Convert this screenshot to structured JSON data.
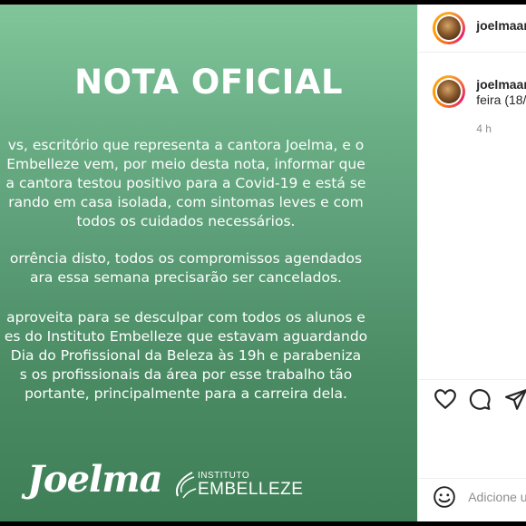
{
  "post": {
    "title": "NOTA OFICIAL",
    "para1": [
      "vs, escritório que representa a cantora Joelma, e o",
      "Embelleze vem, por meio desta nota, informar que",
      "a cantora testou positivo para a Covid-19 e está se",
      "rando em casa isolada, com sintomas leves e com",
      "todos os cuidados necessários."
    ],
    "para2": [
      "orrência disto, todos os compromissos agendados",
      "ara essa semana precisarão ser cancelados."
    ],
    "para3": [
      "aproveita para se desculpar com todos os alunos e",
      "es do Instituto Embelleze que estavam aguardando",
      "Dia do Profissional da Beleza às 19h e parabeniza",
      "s os profissionais da área por esse trabalho tão",
      "portante, principalmente para a carreira dela."
    ],
    "logo_left": "Joelma",
    "logo_right_small": "INSTITUTO",
    "logo_right_big": "EMBELLEZE"
  },
  "sidebar": {
    "header_username": "joelmaar",
    "comment_username": "joelmaar",
    "caption_fragment": "feira (18/",
    "time": "4 h",
    "comment_placeholder": "Adicione u"
  },
  "icons": {
    "like": "heart-icon",
    "comment": "comment-icon",
    "share": "paper-plane-icon",
    "emoji": "smiley-icon"
  }
}
